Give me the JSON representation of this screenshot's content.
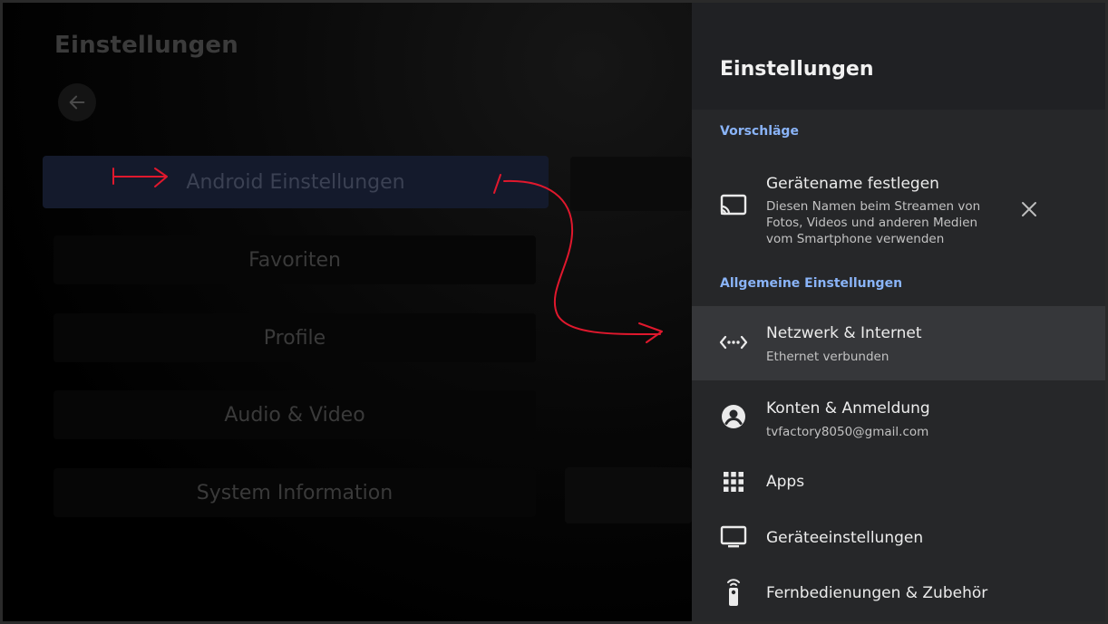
{
  "left": {
    "title": "Einstellungen",
    "menu": [
      {
        "label": "Android Einstellungen"
      },
      {
        "label": "Favoriten"
      },
      {
        "label": "Profile"
      },
      {
        "label": "Audio & Video"
      },
      {
        "label": "System Information"
      }
    ]
  },
  "panel": {
    "title": "Einstellungen",
    "suggestions_label": "Vorschläge",
    "suggestion": {
      "icon": "cast-icon",
      "title": "Gerätename festlegen",
      "subtitle": "Diesen Namen beim Streamen von Fotos, Videos und anderen Medien vom Smartphone verwenden"
    },
    "general_label": "Allgemeine Einstellungen",
    "items": [
      {
        "icon": "network-icon",
        "title": "Netzwerk & Internet",
        "subtitle": "Ethernet verbunden"
      },
      {
        "icon": "account-icon",
        "title": "Konten & Anmeldung",
        "subtitle": "tvfactory8050@gmail.com"
      },
      {
        "icon": "apps-grid-icon",
        "title": "Apps"
      },
      {
        "icon": "tv-icon",
        "title": "Geräteeinstellungen"
      },
      {
        "icon": "remote-icon",
        "title": "Fernbedienungen & Zubehör"
      }
    ]
  },
  "colors": {
    "accent": "#8ab4f8",
    "annotation": "#e0182d",
    "panel_bg": "#262729",
    "focused_row": "#36373a"
  }
}
